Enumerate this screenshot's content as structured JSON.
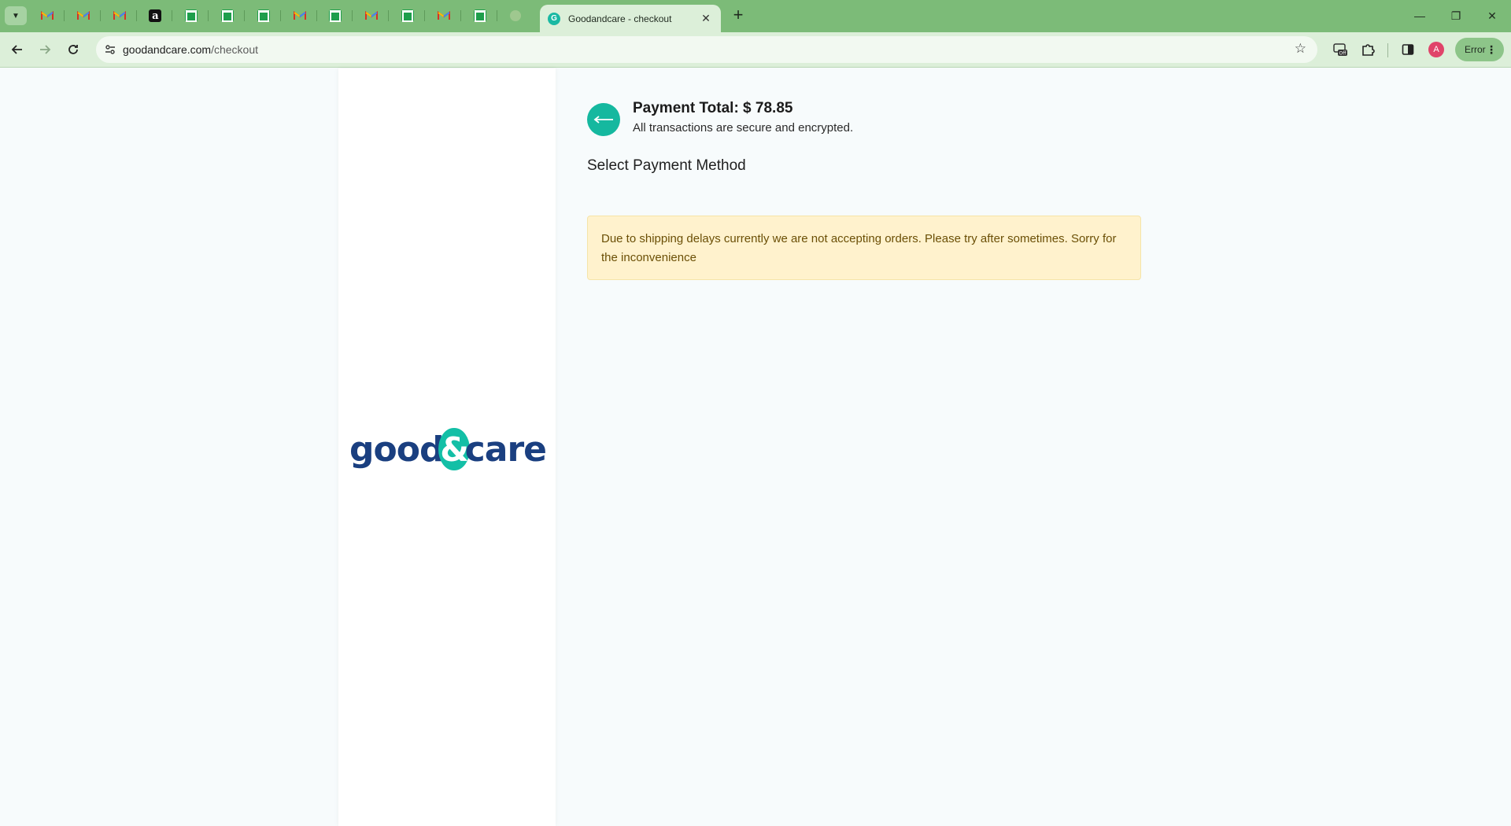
{
  "browser": {
    "pinned_tabs": [
      {
        "icon": "gmail-icon"
      },
      {
        "icon": "gmail-icon"
      },
      {
        "icon": "gmail-icon"
      },
      {
        "icon": "amazon-icon",
        "glyph": "a"
      },
      {
        "icon": "sheets-icon"
      },
      {
        "icon": "sheets-icon"
      },
      {
        "icon": "sheets-icon"
      },
      {
        "icon": "gmail-icon"
      },
      {
        "icon": "sheets-icon"
      },
      {
        "icon": "gmail-icon"
      },
      {
        "icon": "sheets-icon"
      },
      {
        "icon": "gmail-icon"
      },
      {
        "icon": "sheets-icon"
      },
      {
        "icon": "faded-tab-icon"
      }
    ],
    "active_tab": {
      "favicon_letter": "G",
      "title": "Goodandcare - checkout",
      "close": "✕"
    },
    "new_tab": "+",
    "window_controls": {
      "minimize": "—",
      "restore": "❐",
      "close": "✕"
    },
    "address": {
      "host": "goodandcare.com",
      "path": "/checkout"
    },
    "avatar_letter": "A",
    "profile_chip": "Error",
    "colors": {
      "frame": "#7cbb78",
      "toolbar": "#dcefd9"
    }
  },
  "checkout": {
    "brand": {
      "left": "good",
      "amp": "&",
      "right": "care"
    },
    "payment_total": "Payment Total: $ 78.85",
    "secure_note": "All transactions are secure and encrypted.",
    "section_title": "Select Payment Method",
    "alert_message": "Due to shipping delays currently we are not accepting orders. Please try after sometimes. Sorry for the inconvenience",
    "colors": {
      "accent": "#15b89f",
      "brand_blue": "#1a3f80",
      "alert_bg": "#fff2cd",
      "alert_text": "#6b4f06"
    }
  }
}
